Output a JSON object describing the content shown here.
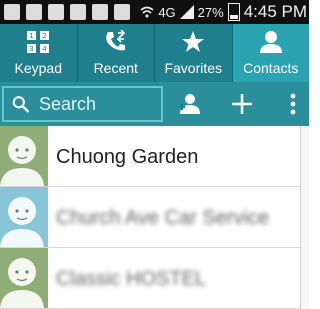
{
  "status_bar": {
    "battery": "27%",
    "network": "4G",
    "time": "4:45 PM"
  },
  "tabs": [
    {
      "label": "Keypad",
      "icon": "keypad-icon",
      "active": false
    },
    {
      "label": "Recent",
      "icon": "recent-calls-icon",
      "active": false
    },
    {
      "label": "Favorites",
      "icon": "star-icon",
      "active": false
    },
    {
      "label": "Contacts",
      "icon": "person-icon",
      "active": true
    }
  ],
  "search": {
    "placeholder": "Search",
    "value": ""
  },
  "contacts": [
    {
      "name": "Chuong Garden",
      "blurred": false
    },
    {
      "name": "Church Ave Car Service",
      "blurred": true
    },
    {
      "name": "Classic HOSTEL",
      "blurred": true
    }
  ],
  "colors": {
    "header": "#1f7f8d",
    "active_tab": "#2aa3b1",
    "search_bar": "#2b8f9b"
  }
}
